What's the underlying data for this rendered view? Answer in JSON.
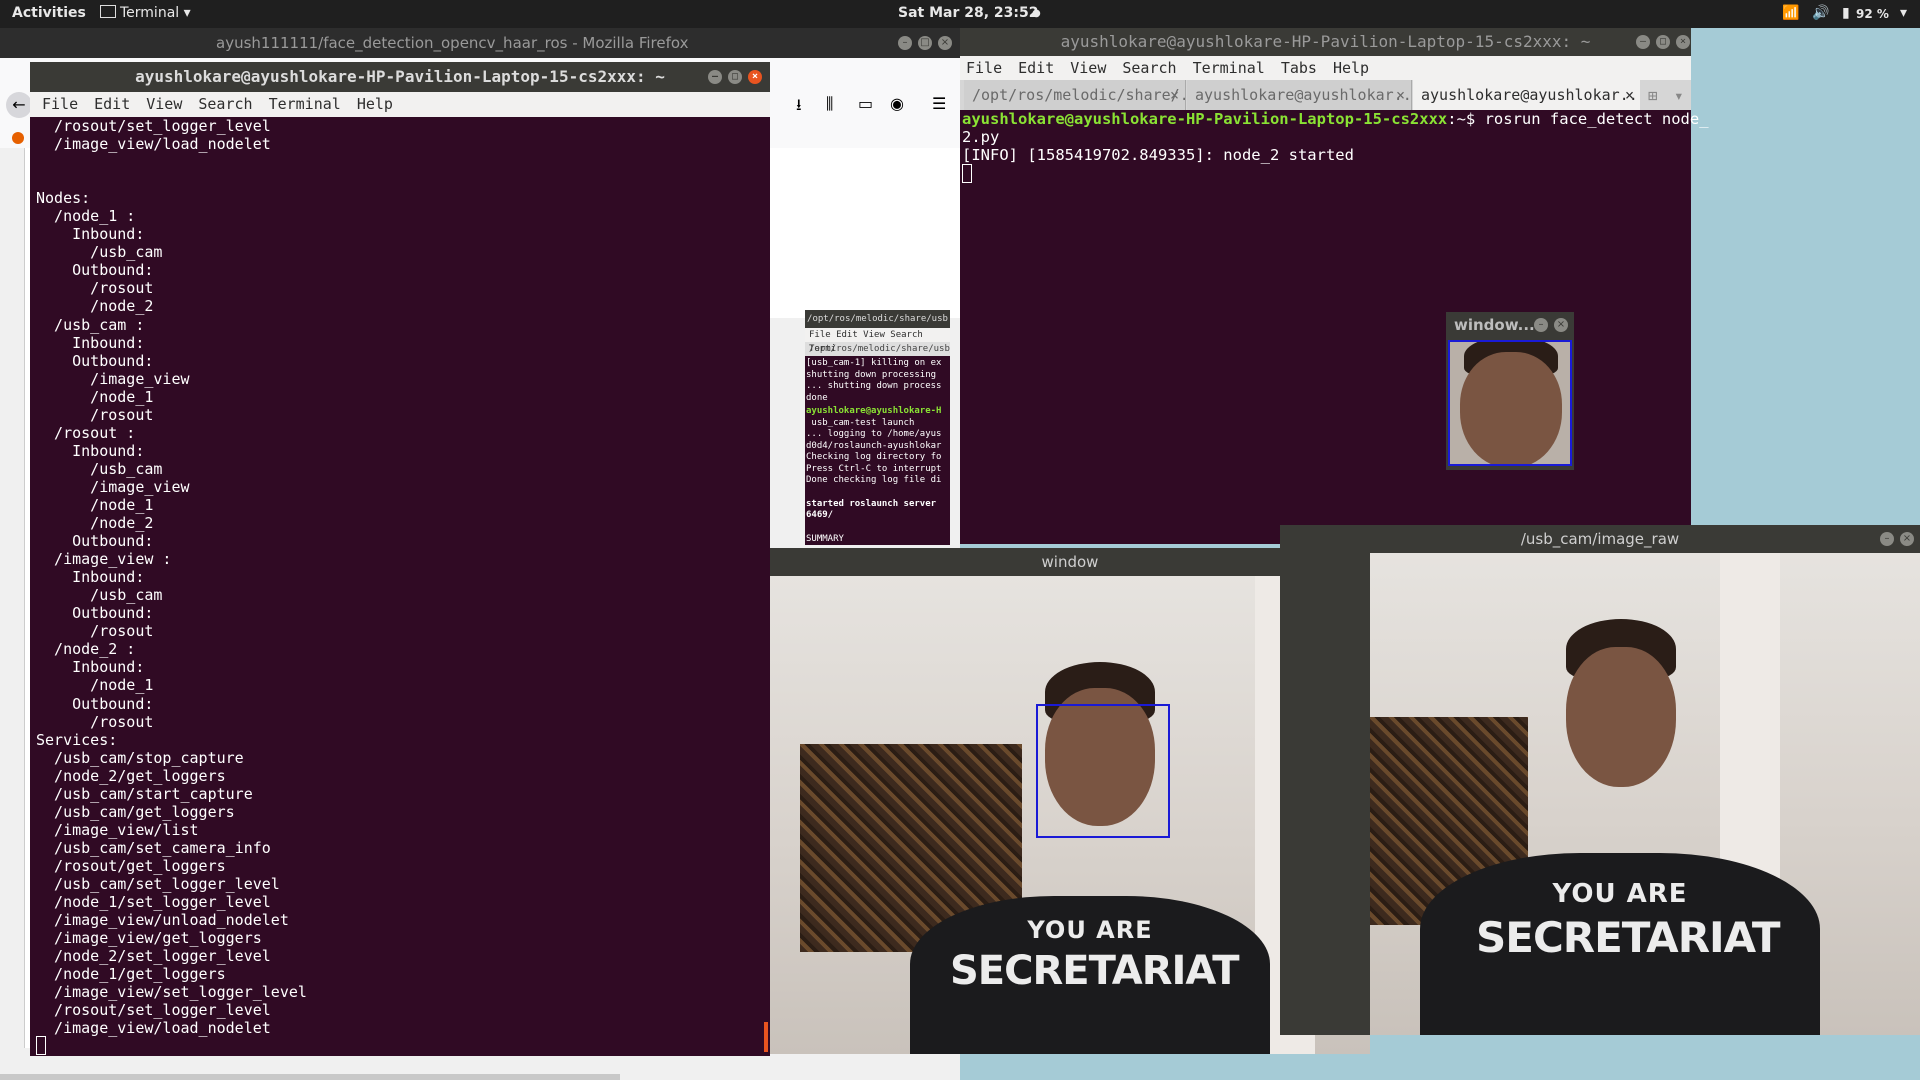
{
  "topbar": {
    "activities": "Activities",
    "app_menu": "Terminal",
    "clock": "Sat Mar 28, 23:52",
    "battery": "92 %"
  },
  "firefox": {
    "title": "ayush111111/face_detection_opencv_haar_ros - Mozilla Firefox"
  },
  "left_terminal": {
    "title": "ayushlokare@ayushlokare-HP-Pavilion-Laptop-15-cs2xxx: ~",
    "menu": [
      "File",
      "Edit",
      "View",
      "Search",
      "Terminal",
      "Help"
    ],
    "content": "  /rosout/set_logger_level\n  /image_view/load_nodelet\n\n\nNodes:\n  /node_1 :\n    Inbound:\n      /usb_cam\n    Outbound:\n      /rosout\n      /node_2\n  /usb_cam :\n    Inbound:\n    Outbound:\n      /image_view\n      /node_1\n      /rosout\n  /rosout :\n    Inbound:\n      /usb_cam\n      /image_view\n      /node_1\n      /node_2\n    Outbound:\n  /image_view :\n    Inbound:\n      /usb_cam\n    Outbound:\n      /rosout\n  /node_2 :\n    Inbound:\n      /node_1\n    Outbound:\n      /rosout\nServices:\n  /usb_cam/stop_capture\n  /node_2/get_loggers\n  /usb_cam/start_capture\n  /usb_cam/get_loggers\n  /image_view/list\n  /usb_cam/set_camera_info\n  /rosout/get_loggers\n  /usb_cam/set_logger_level\n  /node_1/set_logger_level\n  /image_view/unload_nodelet\n  /image_view/get_loggers\n  /node_2/set_logger_level\n  /node_1/get_loggers\n  /image_view/set_logger_level\n  /rosout/set_logger_level\n  /image_view/load_nodelet"
  },
  "right_terminal": {
    "title": "ayushlokare@ayushlokare-HP-Pavilion-Laptop-15-cs2xxx: ~",
    "menu": [
      "File",
      "Edit",
      "View",
      "Search",
      "Terminal",
      "Tabs",
      "Help"
    ],
    "tabs": [
      "/opt/ros/melodic/share/...",
      "ayushlokare@ayushlokar...",
      "ayushlokare@ayushlokar..."
    ],
    "prompt": "ayushlokare@ayushlokare-HP-Pavilion-Laptop-15-cs2xxx",
    "prompt_suffix": ":~$ rosrun face_detect node_",
    "line2": "2.py",
    "line3": "[INFO] [1585419702.849335]: node_2 started"
  },
  "small_terminal": {
    "title": "/opt/ros/melodic/share/usb",
    "menu": "File  Edit  View  Search  Termi",
    "tab": "/opt/ros/melodic/share/usb_ca",
    "content": "[usb_cam-1] killing on ex\nshutting down processing\n... shutting down process\ndone",
    "prompt": "ayushlokare@ayushlokare-H",
    "content2": " usb_cam-test launch\n... logging to /home/ayus\nd0d4/roslaunch-ayushlokar\nChecking log directory fo\nPress Ctrl-C to interrupt\nDone checking log file di",
    "content3": "started roslaunch server\n6469/",
    "content4": "SUMMARY"
  },
  "face_window": {
    "title": "window..."
  },
  "window": {
    "title": "window"
  },
  "raw_window": {
    "title": "/usb_cam/image_raw"
  },
  "shirt_text": {
    "line1": "YOU ARE",
    "line2": "SECRETARIAT"
  },
  "colors": {
    "terminal_bg": "#300a24",
    "prompt_green": "#8ae234",
    "face_box": "#1a1ad6",
    "ubuntu_orange": "#e95420"
  }
}
